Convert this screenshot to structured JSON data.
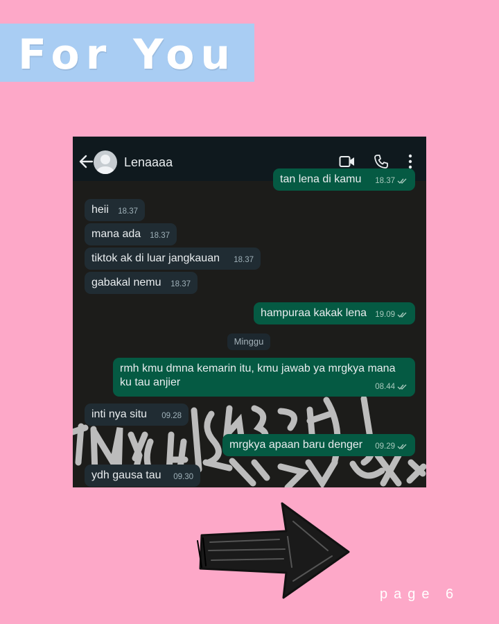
{
  "banner": {
    "title": "For You"
  },
  "chat": {
    "contact_name": "Lenaaaa",
    "messages": [
      {
        "dir": "out",
        "text": "tan lena di kamu",
        "time": "18.37",
        "ticks": true
      },
      {
        "dir": "in",
        "text": "heii",
        "time": "18.37"
      },
      {
        "dir": "in",
        "text": "mana ada",
        "time": "18.37"
      },
      {
        "dir": "in",
        "text": "tiktok ak di luar jangkauan",
        "time": "18.37"
      },
      {
        "dir": "in",
        "text": "gabakal nemu",
        "time": "18.37"
      },
      {
        "dir": "out",
        "text": "hampuraa kakak lena",
        "time": "19.09",
        "ticks": true
      },
      {
        "dir": "out",
        "text": "rmh kmu dmna kemarin itu, kmu jawab ya mrgkya mana ku tau anjier",
        "time": "08.44",
        "ticks": true
      },
      {
        "dir": "in",
        "text": "inti nya situ",
        "time": "09.28"
      },
      {
        "dir": "out",
        "text": "mrgkya apaan baru denger",
        "time": "09.29",
        "ticks": true
      },
      {
        "dir": "in",
        "text": "ydh gausa tau",
        "time": "09.30"
      }
    ],
    "day_separator": "Minggu",
    "icons": [
      "back-arrow-icon",
      "avatar-icon",
      "video-call-icon",
      "phone-icon",
      "more-vertical-icon",
      "double-check-icon"
    ]
  },
  "footer": {
    "page_label": "page 6"
  },
  "colors": {
    "page_background": "#fda8c8",
    "banner_background": "#a9cdf3",
    "chat_header": "#0f191e",
    "incoming_bubble": "#202c33",
    "outgoing_bubble": "#055a43"
  }
}
